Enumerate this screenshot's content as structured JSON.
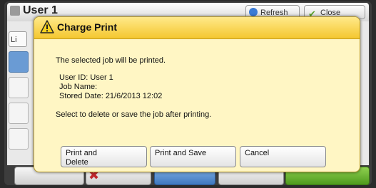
{
  "header": {
    "title": "User 1",
    "refresh_label": "Refresh",
    "close_label": "Close"
  },
  "sidebar": {
    "list_tab_label": "Li"
  },
  "dialog": {
    "title": "Charge Print",
    "message": "The selected job will be printed.",
    "user_id": "User ID: User 1",
    "job_name": "Job Name:",
    "stored_date": "Stored Date: 21/6/2013 12:02",
    "instruction": "Select to delete or save the job after printing.",
    "buttons": {
      "print_delete_line1": "Print and",
      "print_delete_line2": "Delete",
      "print_save": "Print and Save",
      "cancel": "Cancel"
    }
  },
  "colors": {
    "dialog_bg": "#fff6c4",
    "titlebar": "#f4c72f",
    "accent_green": "#5aa02c",
    "accent_blue": "#3f78bf"
  },
  "icons": {
    "dialog": "warning-icon",
    "refresh": "refresh-icon",
    "close": "check-icon"
  }
}
